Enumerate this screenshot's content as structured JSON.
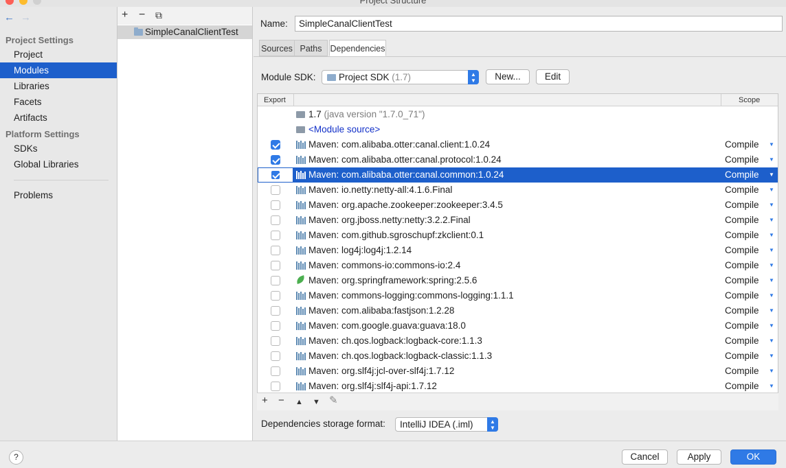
{
  "window": {
    "title": "Project Structure"
  },
  "leftnav": {
    "back_icon": "←",
    "forward_icon": "→",
    "project_settings_header": "Project Settings",
    "project_items": [
      "Project",
      "Modules",
      "Libraries",
      "Facets",
      "Artifacts"
    ],
    "platform_settings_header": "Platform Settings",
    "platform_items": [
      "SDKs",
      "Global Libraries"
    ],
    "problems": "Problems",
    "selected": "Modules"
  },
  "modules": {
    "toolbar": {
      "add": "+",
      "remove": "−",
      "copy": "⧉"
    },
    "items": [
      "SimpleCanalClientTest"
    ]
  },
  "detail": {
    "name_label": "Name:",
    "name_value": "SimpleCanalClientTest",
    "tabs": [
      "Sources",
      "Paths",
      "Dependencies"
    ],
    "active_tab": "Dependencies",
    "sdk_label": "Module SDK:",
    "sdk_value": "Project SDK",
    "sdk_version": "(1.7)",
    "new_button": "New...",
    "edit_button": "Edit",
    "table": {
      "col_export": "Export",
      "col_scope": "Scope",
      "sdk_row": {
        "name": "1.7",
        "detail": "(java version \"1.7.0_71\")"
      },
      "module_source": "<Module source>",
      "rows": [
        {
          "label": "Maven: com.alibaba.otter:canal.client:1.0.24",
          "checked": true,
          "scope": "Compile",
          "icon": "library-icon"
        },
        {
          "label": "Maven: com.alibaba.otter:canal.protocol:1.0.24",
          "checked": true,
          "scope": "Compile",
          "icon": "library-icon"
        },
        {
          "label": "Maven: com.alibaba.otter:canal.common:1.0.24",
          "checked": true,
          "scope": "Compile",
          "icon": "library-icon",
          "selected": true
        },
        {
          "label": "Maven: io.netty:netty-all:4.1.6.Final",
          "checked": false,
          "scope": "Compile",
          "icon": "library-icon"
        },
        {
          "label": "Maven: org.apache.zookeeper:zookeeper:3.4.5",
          "checked": false,
          "scope": "Compile",
          "icon": "library-icon"
        },
        {
          "label": "Maven: org.jboss.netty:netty:3.2.2.Final",
          "checked": false,
          "scope": "Compile",
          "icon": "library-icon"
        },
        {
          "label": "Maven: com.github.sgroschupf:zkclient:0.1",
          "checked": false,
          "scope": "Compile",
          "icon": "library-icon"
        },
        {
          "label": "Maven: log4j:log4j:1.2.14",
          "checked": false,
          "scope": "Compile",
          "icon": "library-icon"
        },
        {
          "label": "Maven: commons-io:commons-io:2.4",
          "checked": false,
          "scope": "Compile",
          "icon": "library-icon"
        },
        {
          "label": "Maven: org.springframework:spring:2.5.6",
          "checked": false,
          "scope": "Compile",
          "icon": "spring-leaf-icon"
        },
        {
          "label": "Maven: commons-logging:commons-logging:1.1.1",
          "checked": false,
          "scope": "Compile",
          "icon": "library-icon"
        },
        {
          "label": "Maven: com.alibaba:fastjson:1.2.28",
          "checked": false,
          "scope": "Compile",
          "icon": "library-icon"
        },
        {
          "label": "Maven: com.google.guava:guava:18.0",
          "checked": false,
          "scope": "Compile",
          "icon": "library-icon"
        },
        {
          "label": "Maven: ch.qos.logback:logback-core:1.1.3",
          "checked": false,
          "scope": "Compile",
          "icon": "library-icon"
        },
        {
          "label": "Maven: ch.qos.logback:logback-classic:1.1.3",
          "checked": false,
          "scope": "Compile",
          "icon": "library-icon"
        },
        {
          "label": "Maven: org.slf4j:jcl-over-slf4j:1.7.12",
          "checked": false,
          "scope": "Compile",
          "icon": "library-icon"
        },
        {
          "label": "Maven: org.slf4j:slf4j-api:1.7.12",
          "checked": false,
          "scope": "Compile",
          "icon": "library-icon"
        }
      ],
      "toolbar": {
        "add": "+",
        "remove": "−",
        "up": "▲",
        "down": "▼",
        "edit": "✎"
      }
    },
    "format_label": "Dependencies storage format:",
    "format_value": "IntelliJ IDEA (.iml)"
  },
  "footer": {
    "help": "?",
    "cancel": "Cancel",
    "apply": "Apply",
    "ok": "OK"
  },
  "colors": {
    "accent": "#2f7ae6",
    "selection": "#1d5fcb",
    "sidebar": "#e8e8e8"
  }
}
